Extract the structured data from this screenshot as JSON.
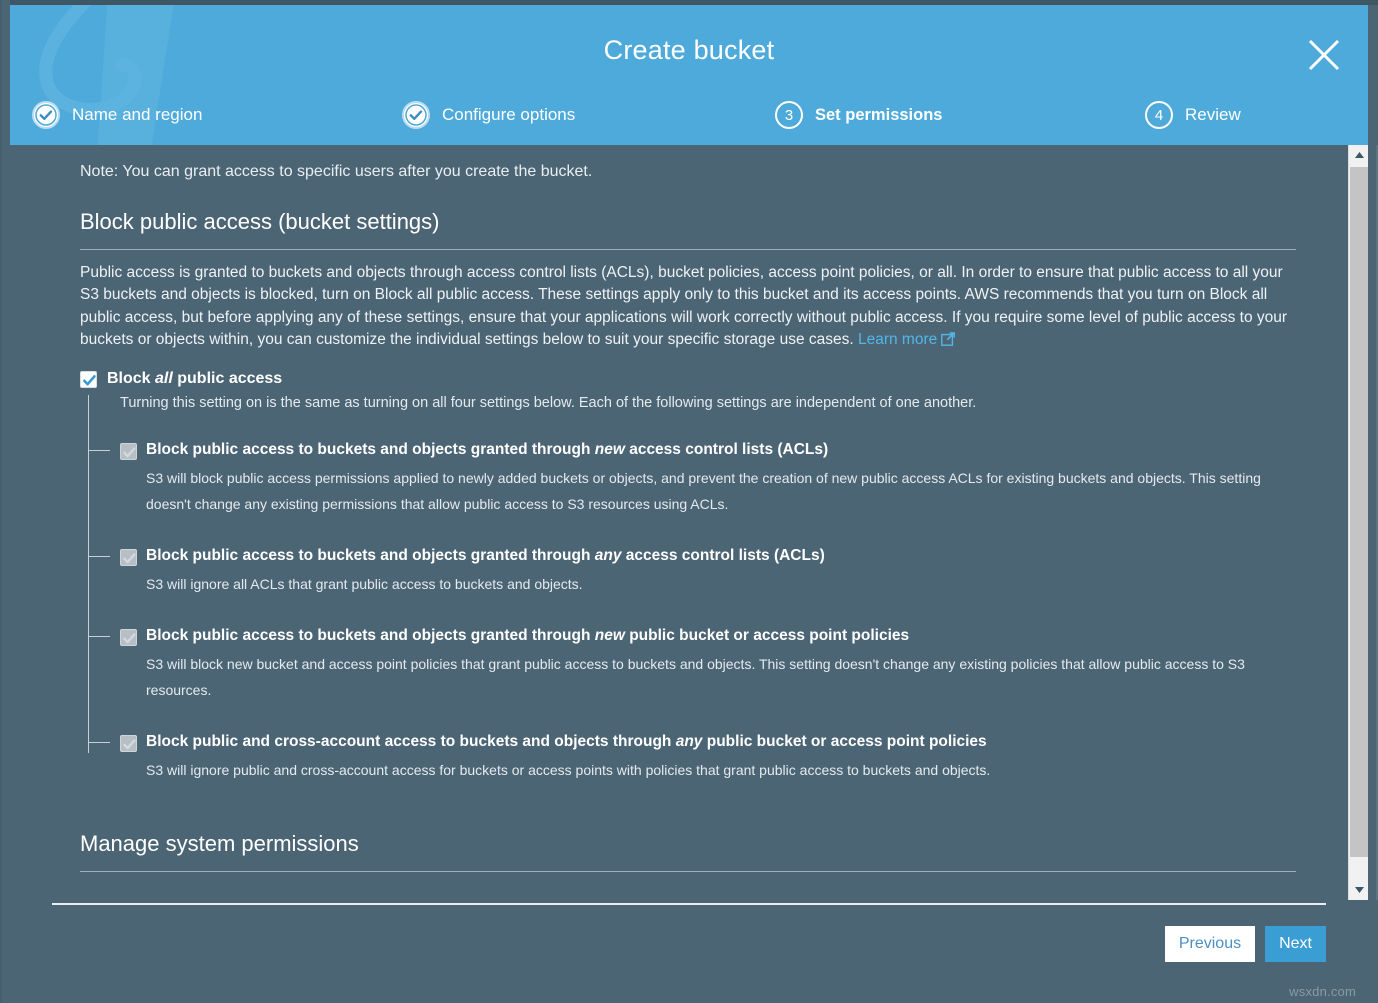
{
  "modal": {
    "title": "Create bucket",
    "close_label": "close-icon"
  },
  "steps": [
    {
      "number": "1",
      "label": "Name and region",
      "state": "done"
    },
    {
      "number": "2",
      "label": "Configure options",
      "state": "done"
    },
    {
      "number": "3",
      "label": "Set permissions",
      "state": "current"
    },
    {
      "number": "4",
      "label": "Review",
      "state": "upcoming"
    }
  ],
  "body": {
    "note": "Note: You can grant access to specific users after you create the bucket.",
    "section_title": "Block public access (bucket settings)",
    "intro_part1": "Public access is granted to buckets and objects through access control lists (ACLs), bucket policies, access point policies, or all. In order to ensure that public access to all your S3 buckets and objects is blocked, turn on Block all public access. These settings apply only to this bucket and its access points. AWS recommends that you turn on Block all public access, but before applying any of these settings, ensure that your applications will work correctly without public access. If you require some level of public access to your buckets or objects within, you can customize the individual settings below to suit your specific storage use cases. ",
    "learn_more": "Learn more",
    "master": {
      "label_prefix": "Block ",
      "label_italic": "all",
      "label_suffix": " public access",
      "checked": true,
      "description": "Turning this setting on is the same as turning on all four settings below. Each of the following settings are independent of one another."
    },
    "sub_settings": [
      {
        "title_prefix": "Block public access to buckets and objects granted through ",
        "title_italic": "new",
        "title_suffix": " access control lists (ACLs)",
        "checked": true,
        "disabled": true,
        "description": "S3 will block public access permissions applied to newly added buckets or objects, and prevent the creation of new public access ACLs for existing buckets and objects. This setting doesn't change any existing permissions that allow public access to S3 resources using ACLs."
      },
      {
        "title_prefix": "Block public access to buckets and objects granted through ",
        "title_italic": "any",
        "title_suffix": " access control lists (ACLs)",
        "checked": true,
        "disabled": true,
        "description": "S3 will ignore all ACLs that grant public access to buckets and objects."
      },
      {
        "title_prefix": "Block public access to buckets and objects granted through ",
        "title_italic": "new",
        "title_suffix": " public bucket or access point policies",
        "checked": true,
        "disabled": true,
        "description": "S3 will block new bucket and access point policies that grant public access to buckets and objects. This setting doesn't change any existing policies that allow public access to S3 resources."
      },
      {
        "title_prefix": "Block public and cross-account access to buckets and objects through ",
        "title_italic": "any",
        "title_suffix": " public bucket or access point policies",
        "checked": true,
        "disabled": true,
        "description": "S3 will ignore public and cross-account access for buckets or access points with policies that grant public access to buckets and objects."
      }
    ],
    "manage_title": "Manage system permissions"
  },
  "footer": {
    "previous_label": "Previous",
    "next_label": "Next"
  },
  "watermark": "wsxdn.com",
  "colors": {
    "header_blue": "#4eaada",
    "body_slate": "#4c6575",
    "link_blue": "#53b6e8",
    "next_button": "#3a9dd4",
    "previous_text": "#4a90c4"
  }
}
